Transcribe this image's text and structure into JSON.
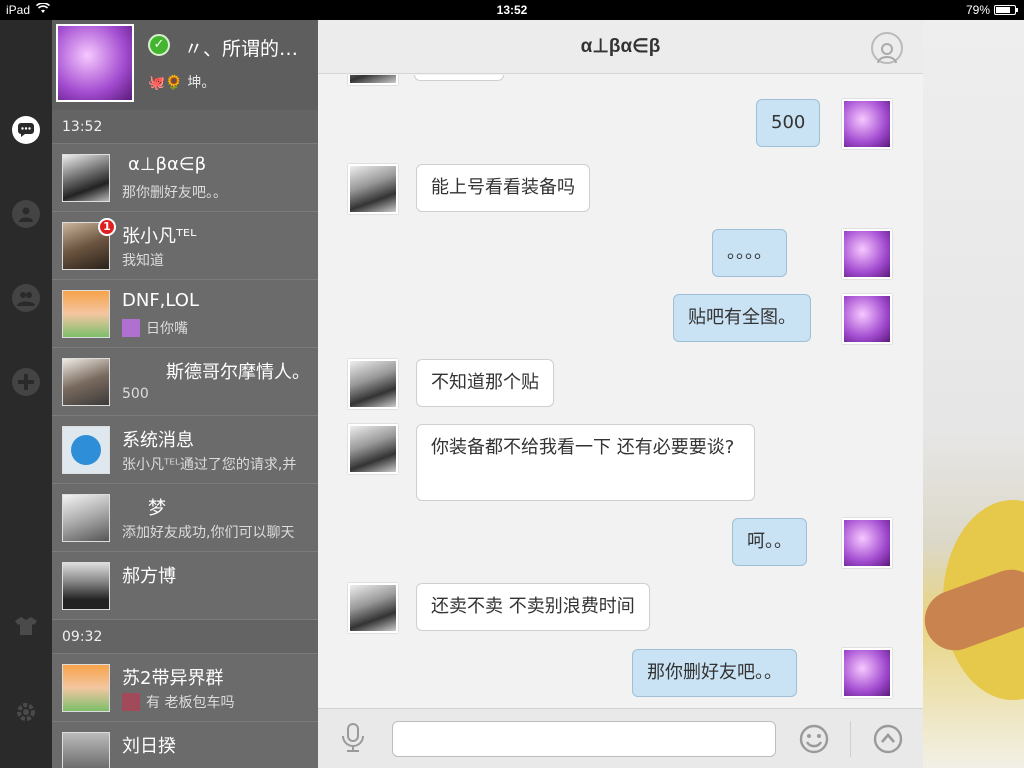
{
  "status_bar": {
    "device": "iPad",
    "time": "13:52",
    "battery": "79%",
    "battery_level": 0.79
  },
  "profile": {
    "name": "〃、所谓的…",
    "signature": "🐙🌻 坤。"
  },
  "conversations": {
    "sections": [
      {
        "time": "13:52",
        "items": [
          {
            "name": "α⊥βα∈β",
            "message": "那你删好友吧。。"
          },
          {
            "name": "张小凡ᵀᴱᴸ",
            "message": "我知道",
            "badge": "1"
          },
          {
            "name": "DNF,LOL",
            "message": "日你嘴"
          },
          {
            "name": "斯德哥尔摩情人。",
            "message": "500"
          },
          {
            "name": "系统消息",
            "message": "张小凡ᵀᴱᴸ通过了您的请求,并"
          },
          {
            "name": "梦",
            "message": "添加好友成功,你们可以聊天"
          },
          {
            "name": "郝方博",
            "message": ""
          }
        ]
      },
      {
        "time": "09:32",
        "items": [
          {
            "name": "苏2带异界群",
            "message": "有 老板包车吗"
          },
          {
            "name": "刘日揆",
            "message": ""
          }
        ]
      }
    ]
  },
  "chat": {
    "title": "α⊥βα∈β",
    "input_placeholder": "",
    "messages": [
      {
        "from": "me",
        "text": "500"
      },
      {
        "from": "friend",
        "text": "能上号看看装备吗"
      },
      {
        "from": "me",
        "text": "。。。。"
      },
      {
        "from": "me",
        "text": "贴吧有全图。"
      },
      {
        "from": "friend",
        "text": "不知道那个贴"
      },
      {
        "from": "friend",
        "text": "你装备都不给我看一下  还有必要要谈?"
      },
      {
        "from": "me",
        "text": "呵。。"
      },
      {
        "from": "friend",
        "text": "还卖不卖 不卖别浪费时间"
      },
      {
        "from": "me",
        "text": "那你删好友吧。。"
      }
    ]
  },
  "icons": {
    "rail": [
      "messages-icon",
      "contacts-icon",
      "groups-icon",
      "discover-icon",
      "theme-icon",
      "settings-icon"
    ],
    "input": [
      "microphone-icon",
      "emoji-icon",
      "expand-up-icon"
    ]
  },
  "colors": {
    "bubble_out": "#c9e3f5",
    "bubble_in": "#ffffff",
    "list_bg": "#6a6a6a"
  }
}
